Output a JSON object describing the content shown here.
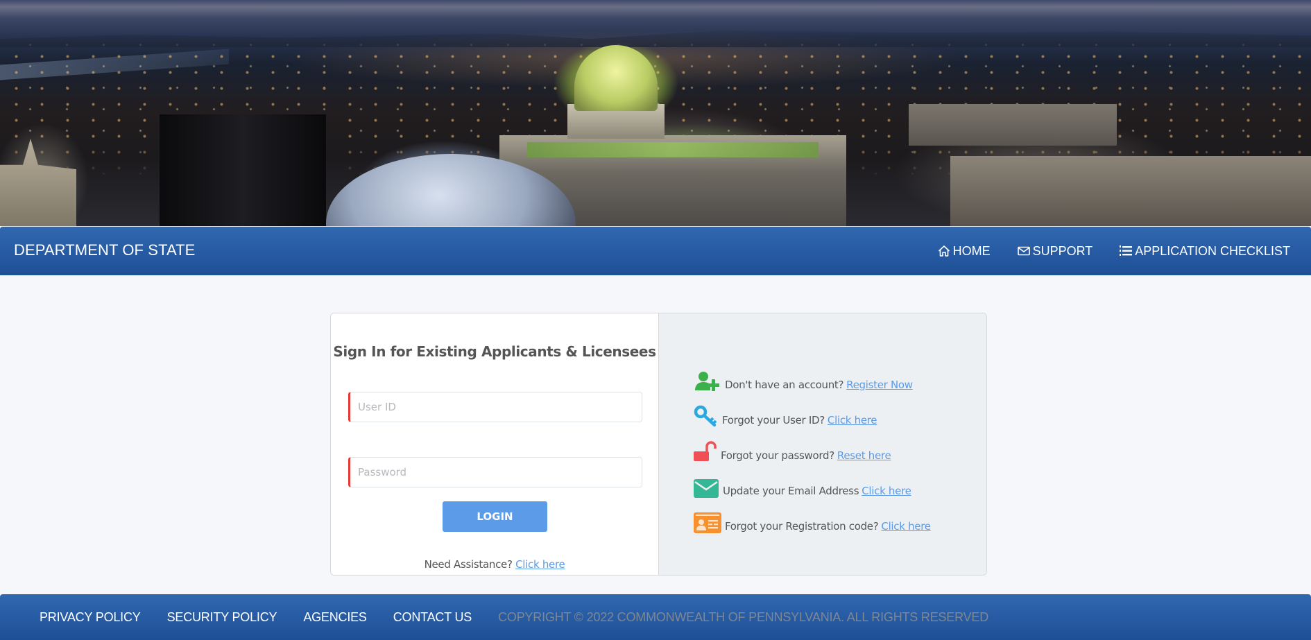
{
  "header": {
    "title": "DEPARTMENT OF STATE",
    "nav": [
      {
        "label": "HOME",
        "icon": "home-icon"
      },
      {
        "label": "SUPPORT",
        "icon": "envelope-icon"
      },
      {
        "label": "APPLICATION CHECKLIST",
        "icon": "numbered-list-icon"
      }
    ]
  },
  "login": {
    "title": "Sign In for Existing Applicants & Licensees",
    "user_id": {
      "value": "",
      "placeholder": "User ID"
    },
    "password": {
      "value": "",
      "placeholder": "Password"
    },
    "login_label": "LOGIN",
    "assistance_text": "Need Assistance?",
    "assistance_link": "Click here"
  },
  "help": {
    "items": [
      {
        "icon": "user-plus-icon",
        "text": "Don't have an account?",
        "link": "Register Now",
        "color": "#3cb04a"
      },
      {
        "icon": "key-icon",
        "text": "Forgot your User ID?",
        "link": "Click here",
        "color": "#2ba8e0"
      },
      {
        "icon": "unlock-icon",
        "text": "Forgot your password?",
        "link": "Reset here",
        "color": "#ef4f55"
      },
      {
        "icon": "envelope-icon",
        "text": "Update your Email Address",
        "link": "Click here",
        "color": "#33b795"
      },
      {
        "icon": "id-card-icon",
        "text": "Forgot your Registration code?",
        "link": "Click here",
        "color": "#f7902e"
      }
    ]
  },
  "footer": {
    "links": [
      "PRIVACY POLICY",
      "SECURITY POLICY",
      "AGENCIES",
      "CONTACT US"
    ],
    "copyright": "COPYRIGHT © 2022 COMMONWEALTH OF PENNSYLVANIA. ALL RIGHTS RESERVED"
  },
  "colors": {
    "nav_blue_top": "#3068b0",
    "nav_blue_bottom": "#1e4f96",
    "login_button": "#5b9be8",
    "link": "#5b9be8",
    "required_marker": "#e53935"
  }
}
